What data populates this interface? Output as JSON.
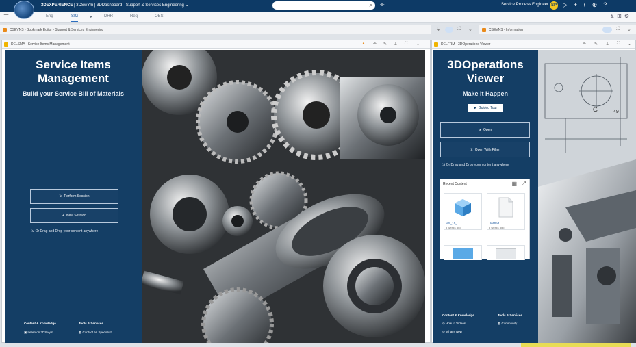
{
  "topbar": {
    "brand_bold": "3DEXPERIENCE",
    "brand_rest": " | 3DSwYm | 3DDashboard",
    "context": "Support & Services Engineering",
    "search_icon": "search-icon",
    "user_name": "Service Process Engineer",
    "avatar_initials": "SP"
  },
  "tabs": [
    {
      "label": "Eng"
    },
    {
      "label": "SIG",
      "active": true
    },
    {
      "label": "DHR"
    },
    {
      "label": "Req"
    },
    {
      "label": "OBS"
    }
  ],
  "panel_bars": {
    "left": "CSEVNS - Bookmark Editor - Support & Services Engineering",
    "right": "CSEVNS - Information"
  },
  "left_panel": {
    "header": "DELSMA - Service Items Management",
    "title_line1": "Service Items",
    "title_line2": "Management",
    "subtitle": "Build your Service Bill of Materials",
    "btn_perform": "Perform Session",
    "btn_new": "New Session",
    "drag_text": "Or Drag and Drop your content anywhere",
    "footer": {
      "col1_head": "Content & Knowledge",
      "col1_item": "Learn on 3DSwym",
      "col2_head": "Tools & Services",
      "col2_item": "Contact an Specialist"
    }
  },
  "right_panel": {
    "header": "DELFRM - 3DOperations Viewer",
    "title_line1": "3DOperations",
    "title_line2": "Viewer",
    "subtitle": "Make It Happen",
    "video_btn": "Guided Tour",
    "btn_open": "Open",
    "btn_open_filter": "Open With Filter",
    "drag_text": "Or Drag and Drop your content anywhere",
    "recent_title": "Recent Content",
    "recent": [
      {
        "name": "MS_10_...",
        "meta": "3 weeks ago"
      },
      {
        "name": "Untitled",
        "meta": "3 weeks ago"
      }
    ],
    "footer": {
      "col1_head": "Content & Knowledge",
      "col1_items": [
        "How to Videos",
        "What's New"
      ],
      "col2_head": "Tools & Services",
      "col2_item": "Community"
    }
  },
  "colors": {
    "topbar": "#0d3a66",
    "side_panel": "#143e65",
    "accent": "#2c6fbf",
    "avatar": "#f3c623"
  }
}
